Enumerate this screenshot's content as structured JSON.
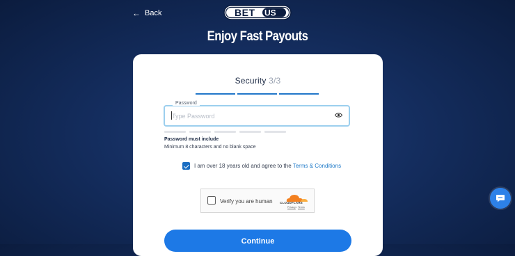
{
  "header": {
    "back_label": "Back",
    "logo_text": "BETUS",
    "headline": "Enjoy Fast Payouts"
  },
  "form": {
    "step_title": "Security",
    "step_count": "3/3",
    "password": {
      "label": "Password",
      "placeholder": "Type Password",
      "value": ""
    },
    "requirements_title": "Password must include",
    "requirements_text": "Minimum 8 characters and no blank space",
    "agree_text": "I am over 18 years old and agree to the ",
    "terms_link": "Terms & Conditions",
    "agree_checked": true,
    "captcha": {
      "label": "Verify you are human",
      "brand": "CLOUDFLARE",
      "privacy": "Privacy",
      "separator": " • ",
      "terms": "Terms"
    },
    "continue_label": "Continue"
  },
  "colors": {
    "background": "#142d5e",
    "accent": "#1d79e6",
    "step_bar": "#2277c9",
    "cloudflare_orange": "#f38020"
  },
  "icons": {
    "back": "arrow-left-icon",
    "password_toggle": "eye-icon",
    "chat": "chat-bubble-icon"
  }
}
